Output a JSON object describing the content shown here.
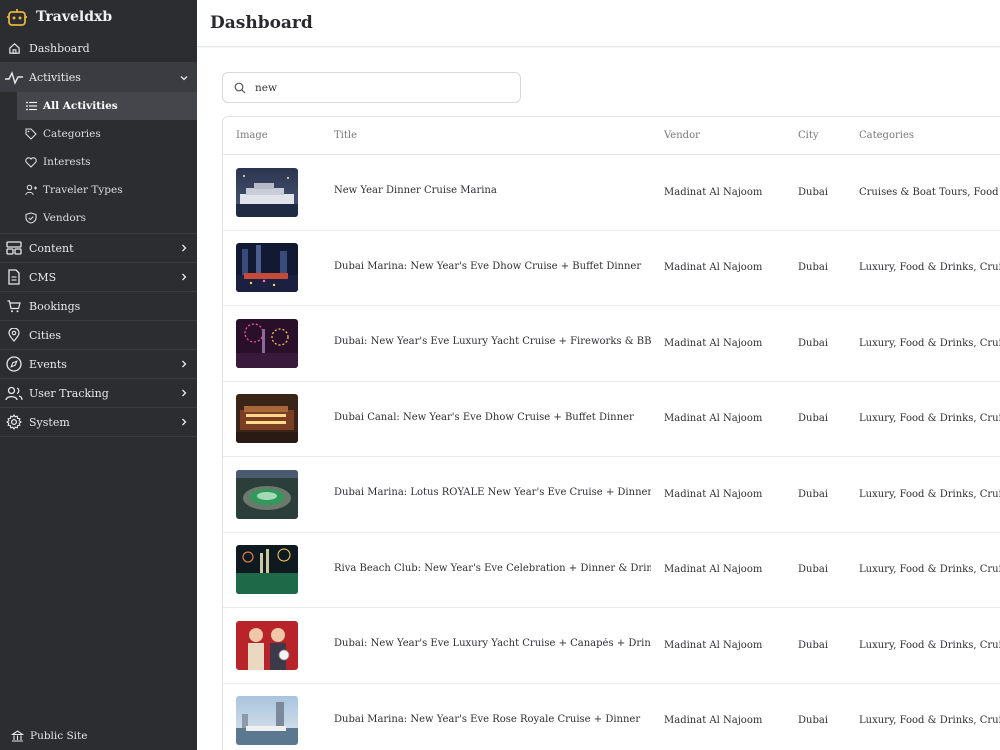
{
  "brand": {
    "name": "Traveldxb",
    "accent": "#e7b43a"
  },
  "sidebar": {
    "items": [
      {
        "label": "Dashboard",
        "icon": "home-icon"
      },
      {
        "label": "Activities",
        "icon": "activity-icon",
        "expanded": true
      },
      {
        "label": "Content",
        "icon": "layout-icon"
      },
      {
        "label": "CMS",
        "icon": "file-icon"
      },
      {
        "label": "Bookings",
        "icon": "cart-icon"
      },
      {
        "label": "Cities",
        "icon": "map-pin-icon"
      },
      {
        "label": "Events",
        "icon": "compass-icon"
      },
      {
        "label": "User Tracking",
        "icon": "users-icon"
      },
      {
        "label": "System",
        "icon": "gear-icon"
      }
    ],
    "activities_sub": [
      {
        "label": "All Activities",
        "icon": "list-icon",
        "active": true
      },
      {
        "label": "Categories",
        "icon": "tag-icon"
      },
      {
        "label": "Interests",
        "icon": "heart-icon"
      },
      {
        "label": "Traveler Types",
        "icon": "user-plus-icon"
      },
      {
        "label": "Vendors",
        "icon": "shield-icon"
      }
    ],
    "public_site": "Public Site"
  },
  "header": {
    "title": "Dashboard"
  },
  "search": {
    "value": "new",
    "placeholder": ""
  },
  "table": {
    "columns": [
      "Image",
      "Title",
      "Vendor",
      "City",
      "Categories"
    ],
    "rows": [
      {
        "title": "New Year Dinner Cruise Marina",
        "vendor": "Madinat Al Najoom",
        "city": "Dubai",
        "categories": "Cruises & Boat Tours, Food & Drinks"
      },
      {
        "title": "Dubai Marina: New Year's Eve Dhow Cruise + Buffet Dinner",
        "vendor": "Madinat Al Najoom",
        "city": "Dubai",
        "categories": "Luxury, Food & Drinks, Cruises"
      },
      {
        "title": "Dubai: New Year's Eve Luxury Yacht Cruise + Fireworks & BBQ Snacks",
        "vendor": "Madinat Al Najoom",
        "city": "Dubai",
        "categories": "Luxury, Food & Drinks, Cruises"
      },
      {
        "title": "Dubai Canal: New Year's Eve Dhow Cruise + Buffet Dinner",
        "vendor": "Madinat Al Najoom",
        "city": "Dubai",
        "categories": "Luxury, Food & Drinks, Cruises"
      },
      {
        "title": "Dubai Marina: Lotus ROYALE New Year's Eve Cruise + Dinner + Soft Drinks",
        "vendor": "Madinat Al Najoom",
        "city": "Dubai",
        "categories": "Luxury, Food & Drinks, Cruises"
      },
      {
        "title": "Riva Beach Club: New Year's Eve Celebration + Dinner & Drinks",
        "vendor": "Madinat Al Najoom",
        "city": "Dubai",
        "categories": "Luxury, Food & Drinks, Cruises"
      },
      {
        "title": "Dubai: New Year's Eve Luxury Yacht Cruise + Canapés + Drinks",
        "vendor": "Madinat Al Najoom",
        "city": "Dubai",
        "categories": "Luxury, Food & Drinks, Cruises"
      },
      {
        "title": "Dubai Marina: New Year's Eve Rose Royale Cruise + Dinner",
        "vendor": "Madinat Al Najoom",
        "city": "Dubai",
        "categories": "Luxury, Food & Drinks, Cruises"
      }
    ]
  }
}
